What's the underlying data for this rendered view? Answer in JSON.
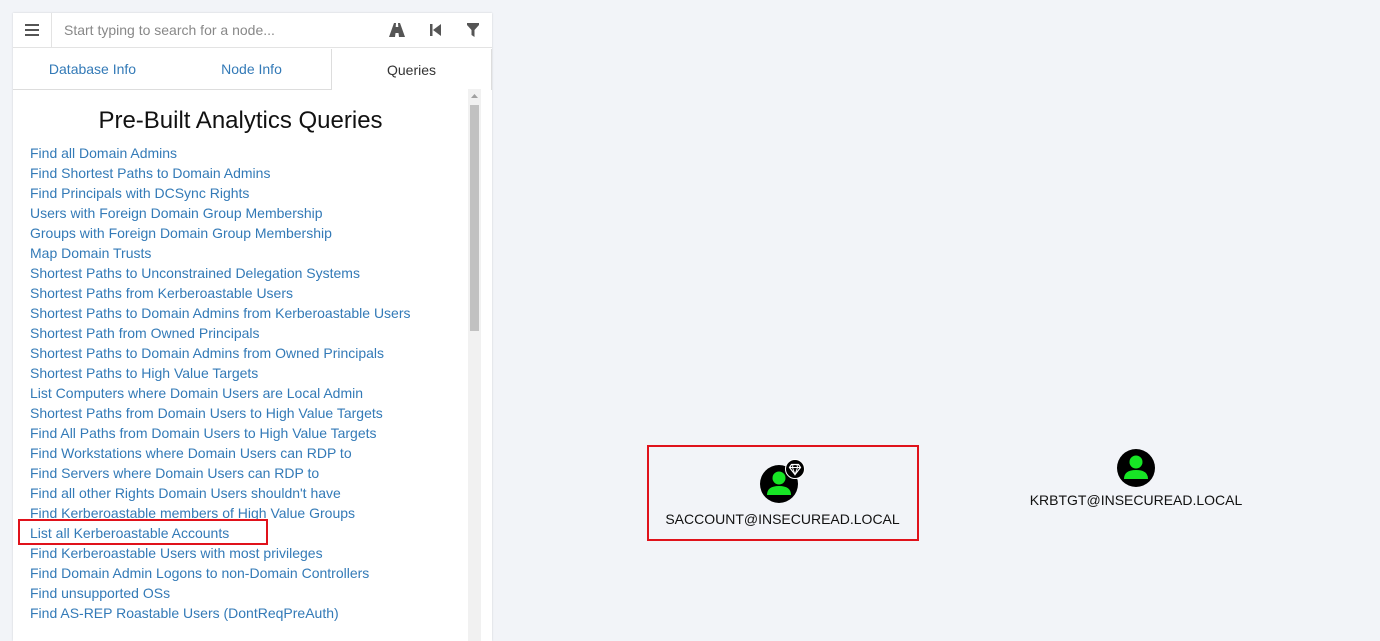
{
  "search": {
    "placeholder": "Start typing to search for a node..."
  },
  "toolbar": {
    "menu_icon": "hamburger-menu-icon",
    "pathfinding_icon": "road-icon",
    "back_icon": "step-backward-icon",
    "filter_icon": "filter-icon"
  },
  "tabs": [
    {
      "label": "Database Info",
      "active": false
    },
    {
      "label": "Node Info",
      "active": false
    },
    {
      "label": "Queries",
      "active": true
    }
  ],
  "queries": {
    "title": "Pre-Built Analytics Queries",
    "items": [
      "Find all Domain Admins",
      "Find Shortest Paths to Domain Admins",
      "Find Principals with DCSync Rights",
      "Users with Foreign Domain Group Membership",
      "Groups with Foreign Domain Group Membership",
      "Map Domain Trusts",
      "Shortest Paths to Unconstrained Delegation Systems",
      "Shortest Paths from Kerberoastable Users",
      "Shortest Paths to Domain Admins from Kerberoastable Users",
      "Shortest Path from Owned Principals",
      "Shortest Paths to Domain Admins from Owned Principals",
      "Shortest Paths to High Value Targets",
      "List Computers where Domain Users are Local Admin",
      "Shortest Paths from Domain Users to High Value Targets",
      "Find All Paths from Domain Users to High Value Targets",
      "Find Workstations where Domain Users can RDP to",
      "Find Servers where Domain Users can RDP to",
      "Find all other Rights Domain Users shouldn't have",
      "Find Kerberoastable members of High Value Groups",
      "List all Kerberoastable Accounts",
      "Find Kerberoastable Users with most privileges",
      "Find Domain Admin Logons to non-Domain Controllers",
      "Find unsupported OSs",
      "Find AS-REP Roastable Users (DontReqPreAuth)"
    ],
    "highlighted": "List all Kerberoastable Accounts"
  },
  "graph": {
    "nodes": [
      {
        "label": "SACCOUNT@INSECUREAD.LOCAL",
        "icon": "user-icon",
        "badge": "high-value-diamond-icon",
        "highlighted": true
      },
      {
        "label": "KRBTGT@INSECUREAD.LOCAL",
        "icon": "user-icon",
        "highlighted": false
      }
    ]
  },
  "colors": {
    "link": "#337ab7",
    "highlight": "#e0121b",
    "user_node_fill": "#17e625",
    "canvas_bg": "#f2f4f8"
  }
}
